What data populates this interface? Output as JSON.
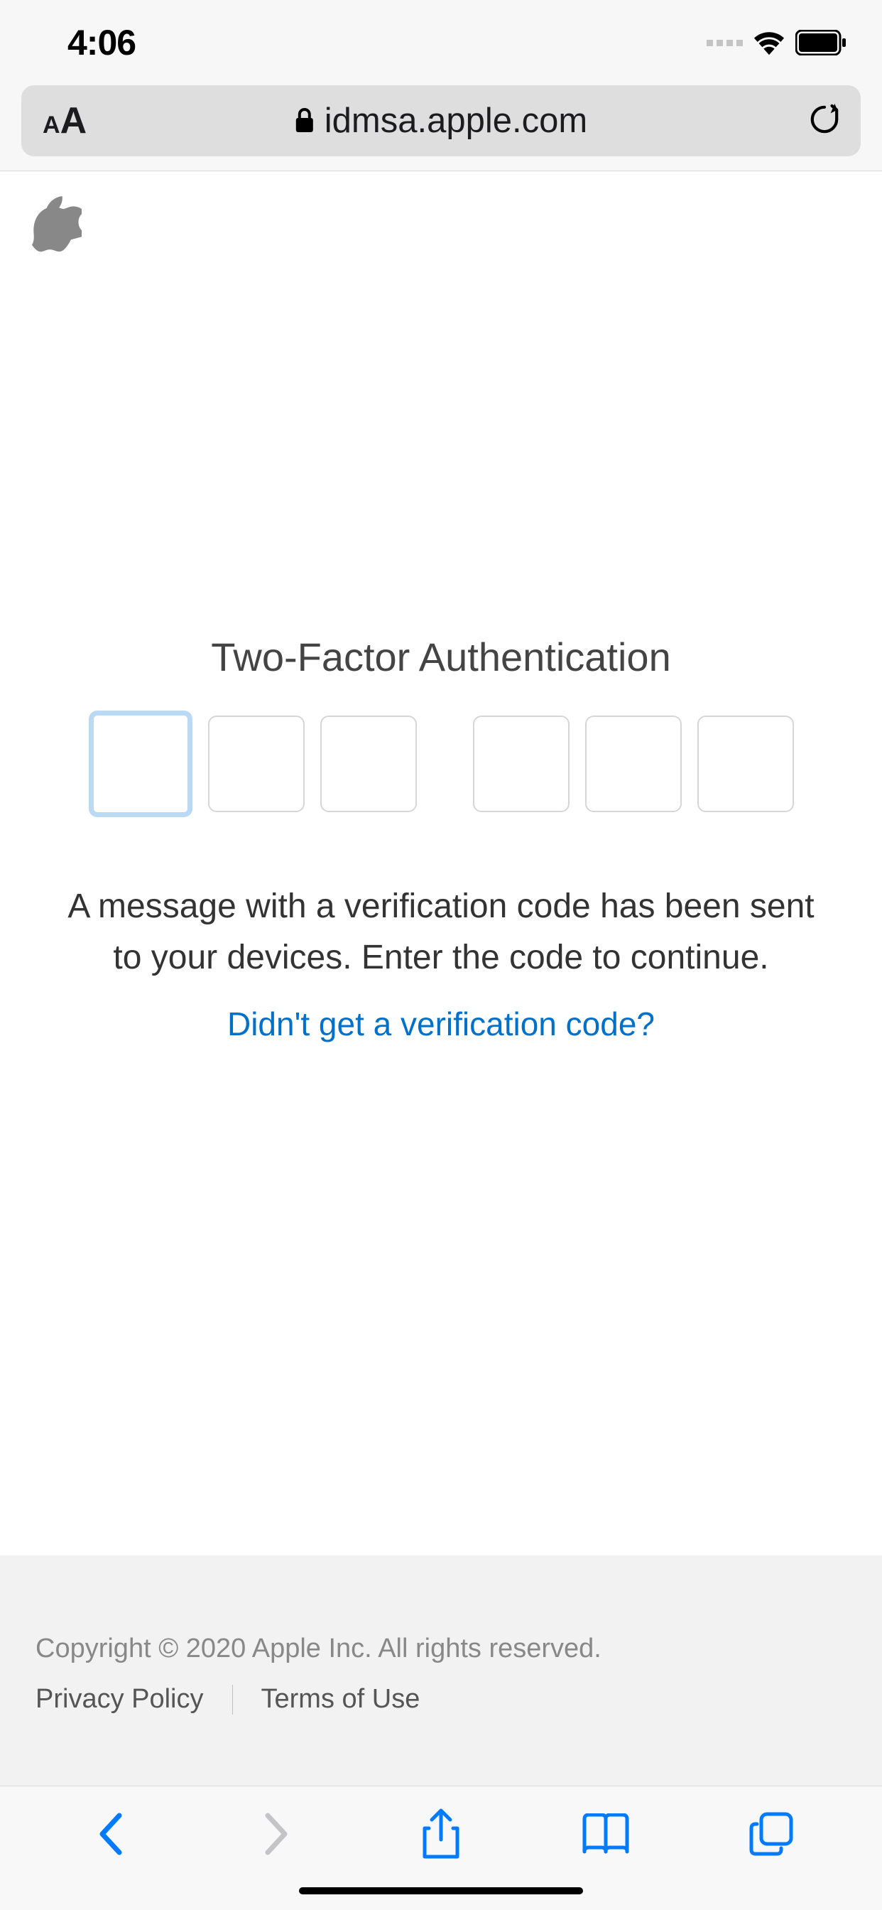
{
  "status": {
    "time": "4:06"
  },
  "urlbar": {
    "domain": "idmsa.apple.com"
  },
  "page": {
    "title": "Two-Factor Authentication",
    "instruction": "A message with a verification code has been sent to your devices. Enter the code to continue.",
    "resend": "Didn't get a verification code?"
  },
  "footer": {
    "copyright": "Copyright © 2020 Apple Inc. All rights reserved.",
    "privacy": "Privacy Policy",
    "terms": "Terms of Use"
  },
  "colors": {
    "link": "#0070c9"
  }
}
